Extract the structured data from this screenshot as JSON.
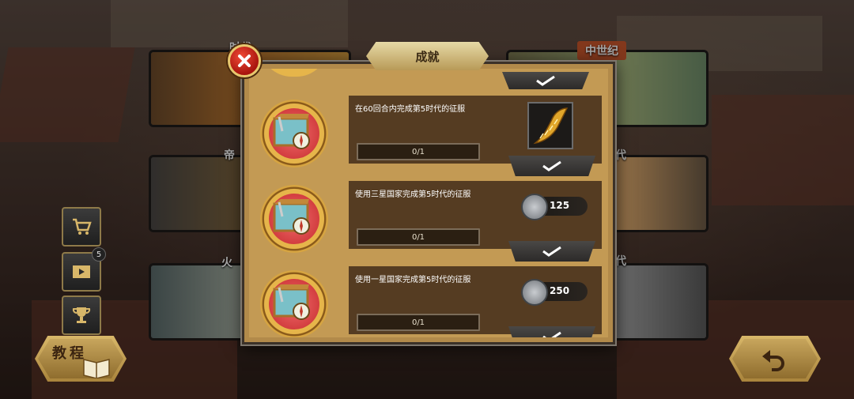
{
  "dialog": {
    "title": "成就"
  },
  "eras": [
    {
      "label": "古…时代",
      "visible_text": "时代"
    },
    {
      "label": "中世纪"
    },
    {
      "label": "帝…"
    },
    {
      "label": "…代"
    },
    {
      "label": "火…"
    },
    {
      "label": "…代"
    }
  ],
  "sidebar": {
    "badge_count": "5"
  },
  "tutorial": {
    "label": "教程"
  },
  "achievements": [
    {
      "desc": "在60回合内完成第5时代的征服",
      "progress": "0/1",
      "reward_type": "item",
      "reward_icon": "golden-dragon-icon"
    },
    {
      "desc": "使用三星国家完成第5时代的征服",
      "progress": "0/1",
      "reward_type": "medal",
      "reward_value": "125"
    },
    {
      "desc": "使用一星国家完成第5时代的征服",
      "progress": "0/1",
      "reward_type": "medal",
      "reward_value": "250"
    }
  ],
  "colors": {
    "dialog_bg": "#c39a54",
    "row_bg": "#553c22",
    "close_red": "#d8281f",
    "gold": "#d8b769"
  }
}
